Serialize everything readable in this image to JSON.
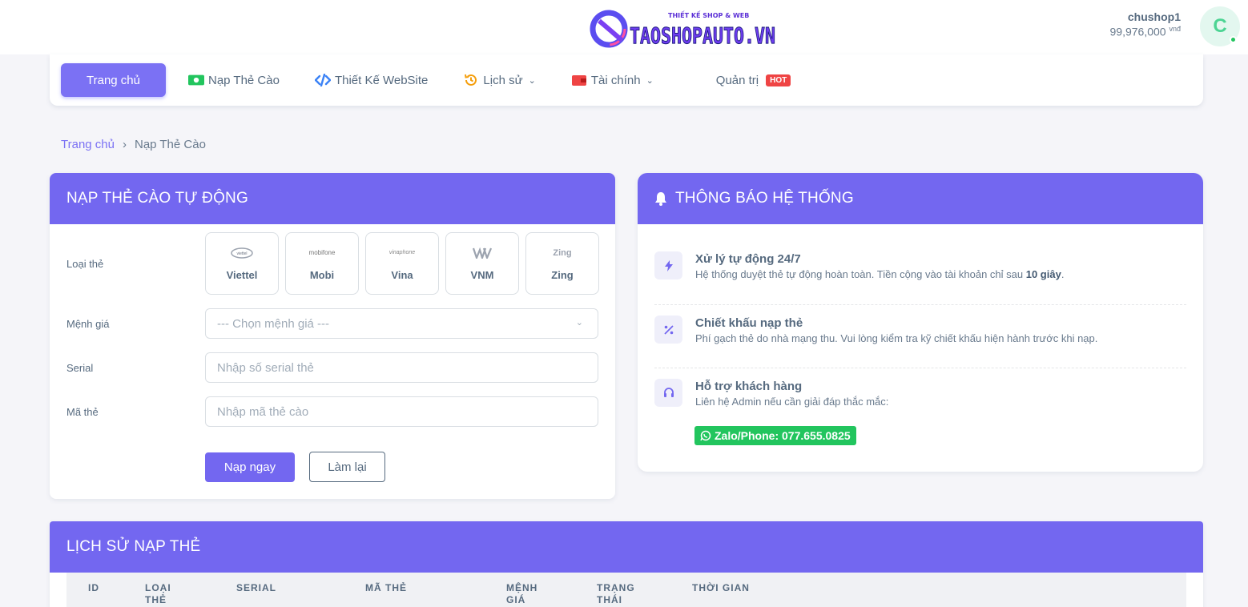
{
  "header": {
    "logo_text": "TAOSHOPAUTO.VN",
    "logo_tagline": "THIẾT KẾ SHOP & WEB",
    "username": "chushop1",
    "balance": "99,976,000",
    "currency": "vnđ",
    "avatar_letter": "C"
  },
  "nav": {
    "items": [
      {
        "label": "Trang chủ"
      },
      {
        "label": "Nạp Thẻ Cào",
        "icon": "money-icon"
      },
      {
        "label": "Thiết Kế WebSite",
        "icon": "code-icon"
      },
      {
        "label": "Lịch sử",
        "icon": "history-icon"
      },
      {
        "label": "Tài chính",
        "icon": "wallet-icon"
      },
      {
        "label": "Quản trị",
        "badge": "HOT"
      }
    ]
  },
  "breadcrumb": {
    "home": "Trang chủ",
    "sep": "›",
    "current": "Nạp Thẻ Cào"
  },
  "topup": {
    "title": "NẠP THẺ CÀO TỰ ĐỘNG",
    "card_type_label": "Loại thẻ",
    "telcos": [
      {
        "name": "Viettel",
        "logo": "viettel"
      },
      {
        "name": "Mobi",
        "logo": "mobifone"
      },
      {
        "name": "Vina",
        "logo": "vinaphone"
      },
      {
        "name": "VNM",
        "logo": ""
      },
      {
        "name": "Zing",
        "logo": "Zing"
      }
    ],
    "amount_label": "Mệnh giá",
    "amount_placeholder": "--- Chọn mệnh giá ---",
    "serial_label": "Serial",
    "serial_placeholder": "Nhập số serial thẻ",
    "code_label": "Mã thẻ",
    "code_placeholder": "Nhập mã thẻ cào",
    "submit": "Nạp ngay",
    "reset": "Làm lại"
  },
  "notice": {
    "title": "THÔNG BÁO HỆ THỐNG",
    "items": [
      {
        "title": "Xử lý tự động 24/7",
        "desc": "Hệ thống duyệt thẻ tự động hoàn toàn. Tiền cộng vào tài khoản chỉ sau ",
        "desc_bold": "10 giây",
        "desc_end": ".",
        "icon": "bolt-icon"
      },
      {
        "title": "Chiết khấu nạp thẻ",
        "desc": "Phí gạch thẻ do nhà mạng thu. Vui lòng kiểm tra kỹ chiết khấu hiện hành trước khi nạp.",
        "icon": "percent-icon"
      },
      {
        "title": "Hỗ trợ khách hàng",
        "desc": "Liên hệ Admin nếu cần giải đáp thắc mắc:",
        "icon": "headset-icon"
      }
    ],
    "contact": "Zalo/Phone: 077.655.0825"
  },
  "history": {
    "title": "LỊCH SỬ NẠP THẺ",
    "columns": [
      "ID",
      "LOẠI THẺ",
      "SERIAL",
      "MÃ THẺ",
      "MỆNH GIÁ",
      "TRẠNG THÁI",
      "THỜI GIAN"
    ]
  },
  "colors": {
    "primary": "#7367f0",
    "success": "#22c55e",
    "hot": "#ef4444"
  }
}
